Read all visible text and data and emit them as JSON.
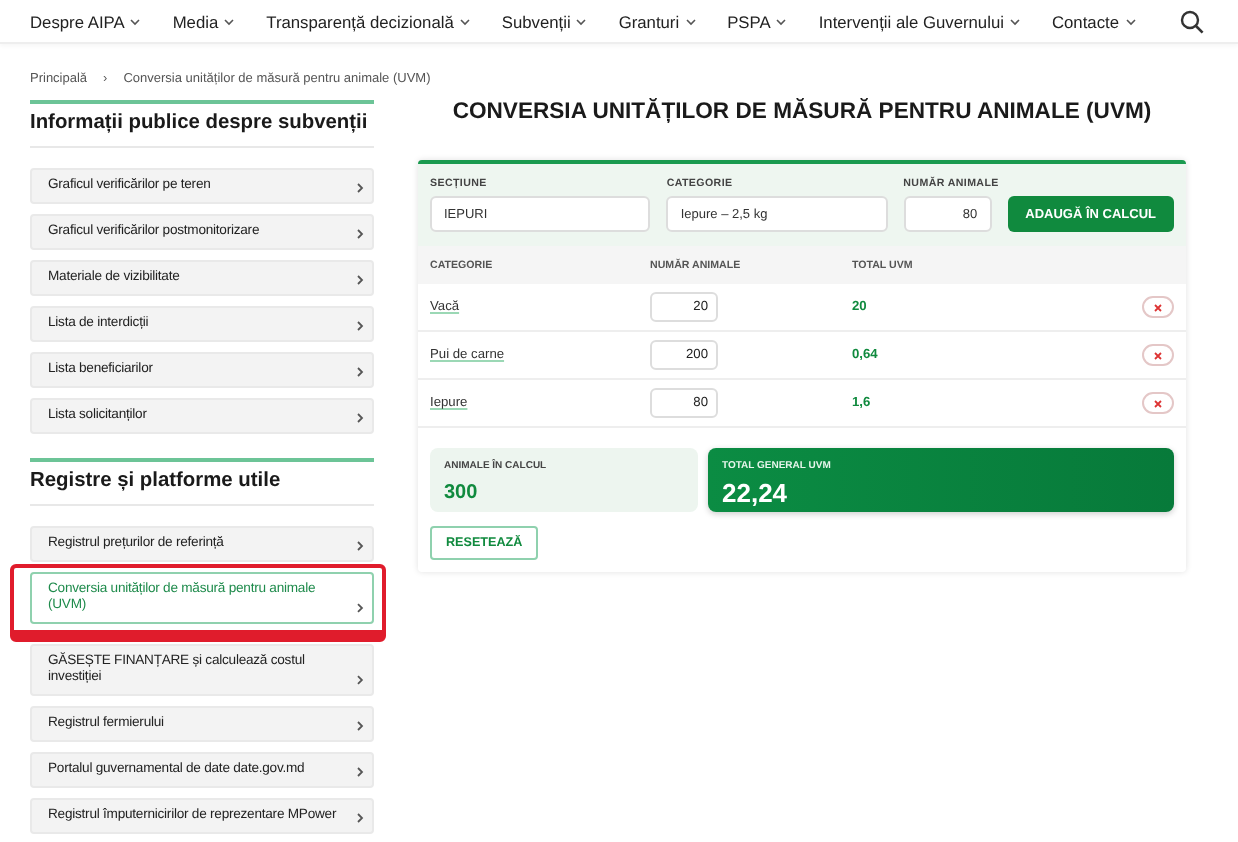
{
  "nav": {
    "items": [
      {
        "label": "Despre AIPA"
      },
      {
        "label": "Media"
      },
      {
        "label": "Transparență decizională"
      },
      {
        "label": "Subvenții"
      },
      {
        "label": "Granturi"
      },
      {
        "label": "PSPA"
      },
      {
        "label": "Intervenții ale Guvernului"
      },
      {
        "label": "Contacte"
      }
    ]
  },
  "breadcrumb": {
    "items": [
      "Principală",
      "Conversia unităților de măsură pentru animale (UVM)"
    ],
    "separator": "›"
  },
  "sidebar": {
    "sections": [
      {
        "title": "Informații publice despre subvenții",
        "items": [
          {
            "label": "Graficul verificărilor pe teren",
            "selected": false
          },
          {
            "label": "Graficul verificărilor postmonitorizare",
            "selected": false
          },
          {
            "label": "Materiale de vizibilitate",
            "selected": false
          },
          {
            "label": "Lista de interdicții",
            "selected": false
          },
          {
            "label": "Lista beneficiarilor",
            "selected": false
          },
          {
            "label": "Lista solicitanților",
            "selected": false
          }
        ]
      },
      {
        "title": "Registre și platforme utile",
        "items": [
          {
            "label": "Registrul prețurilor de referință",
            "selected": false
          },
          {
            "label": "Conversia unităților de măsură pentru animale (UVM)",
            "selected": true
          },
          {
            "label": "GĂSEȘTE FINANȚARE și calculează costul investiției",
            "selected": false
          },
          {
            "label": "Registrul fermierului",
            "selected": false
          },
          {
            "label": "Portalul guvernamental de date date.gov.md",
            "selected": false
          },
          {
            "label": "Registrul împuternicirilor de reprezentare MPower",
            "selected": false
          }
        ]
      }
    ]
  },
  "calculator": {
    "title": "CONVERSIA UNITĂȚILOR DE MĂSURĂ PENTRU ANIMALE (UVM)",
    "form": {
      "fields": [
        {
          "label": "SECȚIUNE",
          "value": "IEPURI",
          "kind": "select"
        },
        {
          "label": "CATEGORIE",
          "value": "Iepure – 2,5 kg",
          "kind": "select"
        },
        {
          "label": "NUMĂR ANIMALE",
          "value": "80",
          "kind": "number"
        }
      ],
      "add_button": "ADAUGĂ ÎN CALCUL"
    },
    "table": {
      "columns": [
        "CATEGORIE",
        "NUMĂR ANIMALE",
        "TOTAL UVM"
      ],
      "rows": [
        {
          "category": "Vacă",
          "count": "20",
          "total": "20"
        },
        {
          "category": "Pui de carne",
          "count": "200",
          "total": "0,64"
        },
        {
          "category": "Iepure",
          "count": "80",
          "total": "1,6"
        }
      ]
    },
    "summary": {
      "animals": {
        "label": "ANIMALE ÎN CALCUL",
        "value": "300"
      },
      "total": {
        "label": "TOTAL GENERAL UVM",
        "value": "22,24"
      }
    },
    "reset_button": "RESETEAZĂ"
  }
}
